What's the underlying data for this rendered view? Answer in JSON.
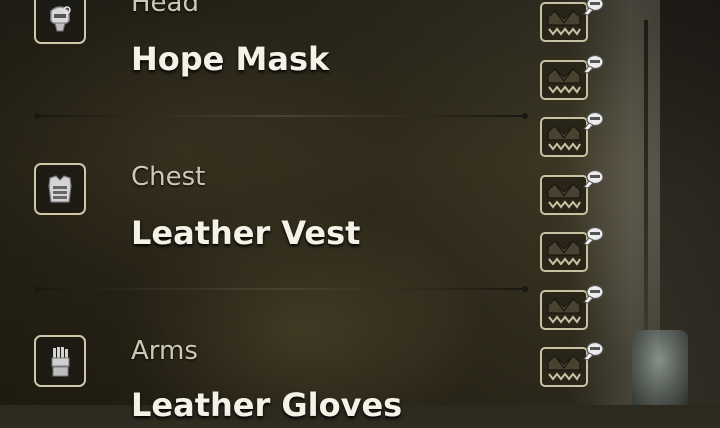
{
  "equipment": {
    "slots": [
      {
        "category": "Head",
        "name": "Hope Mask",
        "icon": "helmet-icon"
      },
      {
        "category": "Chest",
        "name": "Leather Vest",
        "icon": "chest-armor-icon"
      },
      {
        "category": "Arms",
        "name": "Leather Gloves",
        "icon": "gauntlet-icon"
      }
    ]
  },
  "decorations": {
    "count": 7,
    "icon": "decoration-slot-icon",
    "badge_icon": "gem-badge-icon"
  },
  "colors": {
    "frame": "#cfc7a8",
    "name_text": "#f4f1e6",
    "category_text": "#cdc8b2"
  }
}
